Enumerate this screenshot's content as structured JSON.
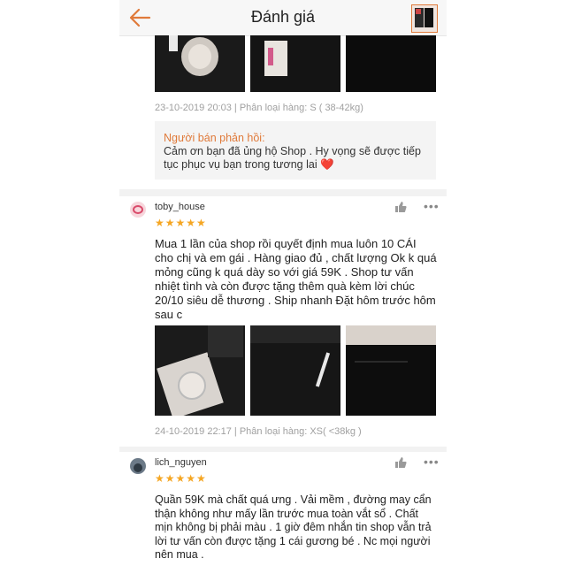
{
  "header": {
    "title": "Đánh giá",
    "back_icon": "back-arrow-icon",
    "accent": "#e07a3a"
  },
  "review_prev": {
    "meta": "23-10-2019 20:03 | Phân loại hàng: S ( 38-42kg)",
    "seller_reply": {
      "heading": "Người bán phản hồi:",
      "body": "Cảm ơn bạn đã ủng hộ Shop . Hy vọng sẽ được tiếp tục phục vụ  bạn trong tương lai ❤️"
    }
  },
  "reviews": [
    {
      "username": "toby_house",
      "stars": "★★★★★",
      "text": "Mua 1 lần của shop rồi quyết định mua luôn 10 CÁI cho chị và em gái . Hàng giao đủ , chất lượng Ok k quá mỏng cũng k quá dày  so với giá 59K . Shop tư vấn nhiệt tình và còn được tặng thêm quà kèm lời chúc 20/10 siêu dễ thương .  Ship nhanh Đặt hôm trước hôm sau c",
      "meta": "24-10-2019 22:17 | Phân loại hàng: XS( <38kg  )"
    },
    {
      "username": "lich_nguyen",
      "stars": "★★★★★",
      "text": " Quần 59K mà chất quá ưng . Vải mềm , đường may cẩn thận không như mấy lần trước mua toàn vắt sổ . Chất mịn không bị phải màu .  1 giờ đêm nhắn tin shop vẫn trả lời tư vấn còn được tặng 1 cái gương bé . Nc mọi người nên mua ."
    }
  ]
}
